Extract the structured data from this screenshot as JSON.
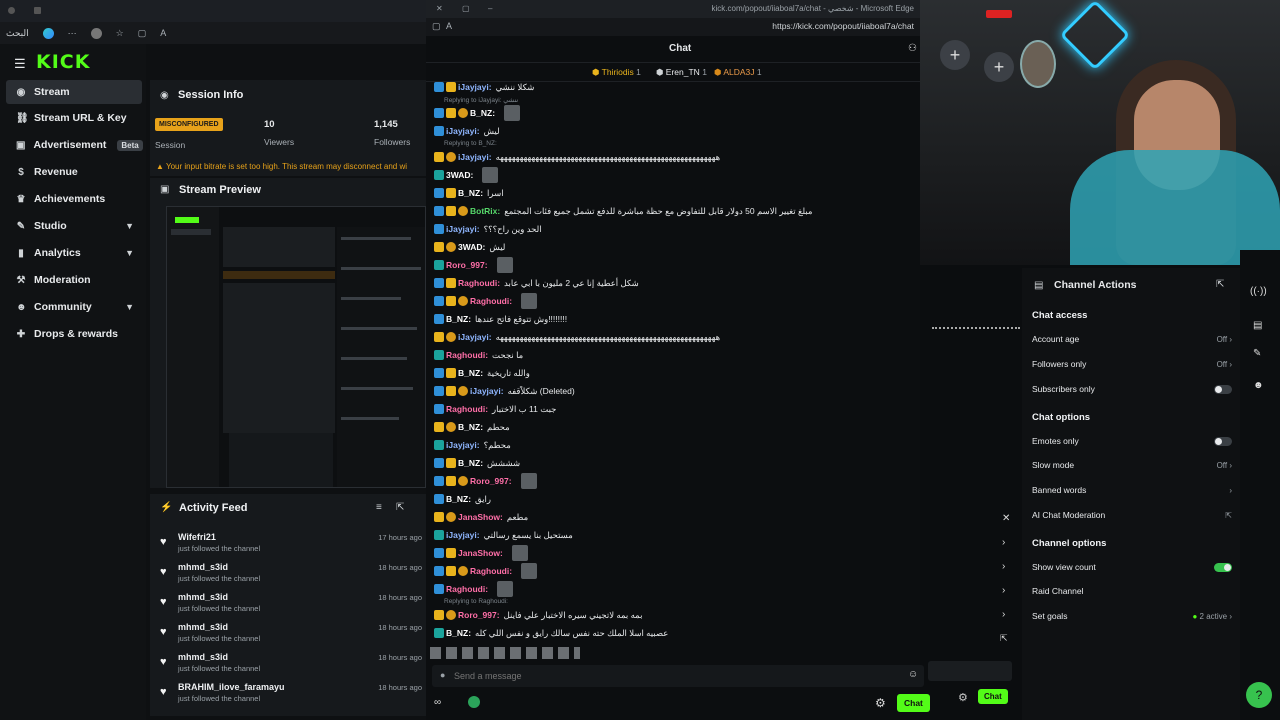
{
  "browser": {
    "search_label": "البحث",
    "chat_window_title": "kick.com/popout/iiaboal7a/chat - شخصي - Microsoft Edge",
    "chat_url": "https://kick.com/popout/iiaboal7a/chat"
  },
  "sidebar": {
    "logo": "KICK",
    "items": [
      {
        "label": "Stream",
        "icon": "broadcast-icon"
      },
      {
        "label": "Stream URL & Key",
        "icon": "link-icon"
      },
      {
        "label": "Advertisement",
        "icon": "ad-icon",
        "badge": "Beta"
      },
      {
        "label": "Revenue",
        "icon": "money-icon"
      },
      {
        "label": "Achievements",
        "icon": "trophy-icon"
      },
      {
        "label": "Studio",
        "icon": "palette-icon"
      },
      {
        "label": "Analytics",
        "icon": "chart-icon"
      },
      {
        "label": "Moderation",
        "icon": "hammer-icon"
      },
      {
        "label": "Community",
        "icon": "people-icon"
      },
      {
        "label": "Drops & rewards",
        "icon": "gift-icon"
      }
    ]
  },
  "session": {
    "title": "Session Info",
    "status_badge": "MISCONFIGURED",
    "status_label": "Session",
    "viewers_value": "10",
    "viewers_label": "Viewers",
    "followers_value": "1,145",
    "followers_label": "Followers",
    "warning": "Your input bitrate is set too high. This stream may disconnect and wi"
  },
  "preview": {
    "title": "Stream Preview"
  },
  "activity": {
    "title": "Activity Feed",
    "items": [
      {
        "name": "Wifefri21",
        "sub": "just followed the channel",
        "time": "17 hours ago"
      },
      {
        "name": "mhmd_s3id",
        "sub": "just followed the channel",
        "time": "18 hours ago"
      },
      {
        "name": "mhmd_s3id",
        "sub": "just followed the channel",
        "time": "18 hours ago"
      },
      {
        "name": "mhmd_s3id",
        "sub": "just followed the channel",
        "time": "18 hours ago"
      },
      {
        "name": "mhmd_s3id",
        "sub": "just followed the channel",
        "time": "18 hours ago"
      },
      {
        "name": "BRAHIM_ilove_faramayu",
        "sub": "just followed the channel",
        "time": "18 hours ago"
      }
    ]
  },
  "chat": {
    "title": "Chat",
    "pinned": [
      {
        "name": "Thiriodis",
        "count": "1"
      },
      {
        "name": "Eren_TN",
        "count": "1"
      },
      {
        "name": "ALDA3J",
        "count": "1"
      }
    ],
    "messages": [
      {
        "user": "iJayjayi:",
        "color": "#8fb6ff",
        "text": "شكلا ننشي",
        "reply": ""
      },
      {
        "user": "B_NZ:",
        "color": "#ffffff",
        "text": "",
        "reply": "Replying to iJayjayi: ننشي"
      },
      {
        "user": "iJayjayi:",
        "color": "#8fb6ff",
        "text": "ليش",
        "reply": ""
      },
      {
        "user": "iJayjayi:",
        "color": "#8fb6ff",
        "text": "ههههههههههههههههههههههههههههههههههههههههههههههههههههههههه",
        "reply": "Replying to B_NZ:"
      },
      {
        "user": "3WAD:",
        "color": "#ffffff",
        "text": "",
        "reply": ""
      },
      {
        "user": "B_NZ:",
        "color": "#ffffff",
        "text": "اسرا",
        "reply": ""
      },
      {
        "user": "BotRix:",
        "color": "#56d86a",
        "text": "مبلغ تغيير الاسم 50 دولار قابل للتفاوض مع حظة مباشرة للدفع تشمل جميع فئات المجتمع",
        "reply": ""
      },
      {
        "user": "iJayjayi:",
        "color": "#8fb6ff",
        "text": "الحد وين راح؟؟؟",
        "reply": ""
      },
      {
        "user": "3WAD:",
        "color": "#ffffff",
        "text": "ليش",
        "reply": ""
      },
      {
        "user": "Roro_997:",
        "color": "#ff6fa8",
        "text": "",
        "reply": ""
      },
      {
        "user": "Raghoudi:",
        "color": "#ff6fa8",
        "text": "شكل أعطية إنا عي 2 مليون با ابي عابد",
        "reply": ""
      },
      {
        "user": "Raghoudi:",
        "color": "#ff6fa8",
        "text": "",
        "reply": ""
      },
      {
        "user": "B_NZ:",
        "color": "#ffffff",
        "text": "وش تتوقع فاتح عندها!!!!!!!!",
        "reply": ""
      },
      {
        "user": "iJayjayi:",
        "color": "#8fb6ff",
        "text": "ههههههههههههههههههههههههههههههههههههههههههههههههههههههههه",
        "reply": ""
      },
      {
        "user": "Raghoudi:",
        "color": "#ff6fa8",
        "text": "ما نجحت",
        "reply": ""
      },
      {
        "user": "B_NZ:",
        "color": "#ffffff",
        "text": "والله تاريخية",
        "reply": ""
      },
      {
        "user": "iJayjayi:",
        "color": "#8fb6ff",
        "text": "شكلاًقفه (Deleted)",
        "reply": ""
      },
      {
        "user": "Raghoudi:",
        "color": "#ff6fa8",
        "text": "جبت 11 ب الاختبار",
        "reply": ""
      },
      {
        "user": "B_NZ:",
        "color": "#ffffff",
        "text": "محطم",
        "reply": ""
      },
      {
        "user": "iJayjayi:",
        "color": "#8fb6ff",
        "text": "محطم؟",
        "reply": ""
      },
      {
        "user": "B_NZ:",
        "color": "#ffffff",
        "text": "شششش",
        "reply": ""
      },
      {
        "user": "Roro_997:",
        "color": "#ff6fa8",
        "text": "",
        "reply": ""
      },
      {
        "user": "B_NZ:",
        "color": "#ffffff",
        "text": "رايق",
        "reply": ""
      },
      {
        "user": "JanaShow:",
        "color": "#ff6fa8",
        "text": "مطعم",
        "reply": ""
      },
      {
        "user": "iJayjayi:",
        "color": "#8fb6ff",
        "text": "مستحيل بنا يسمع رسالتي",
        "reply": ""
      },
      {
        "user": "JanaShow:",
        "color": "#ff6fa8",
        "text": "",
        "reply": ""
      },
      {
        "user": "Raghoudi:",
        "color": "#ff6fa8",
        "text": "",
        "reply": ""
      },
      {
        "user": "Raghoudi:",
        "color": "#ff6fa8",
        "text": "",
        "reply": ""
      },
      {
        "user": "Roro_997:",
        "color": "#ff6fa8",
        "text": "بمه بمه لاتجيني سيره الاختبار علي فاينل",
        "reply": "Replying to Raghoudi:"
      },
      {
        "user": "B_NZ:",
        "color": "#ffffff",
        "text": "عصبيه اسلا الملك حته نفس سالك رايق و نفس اللي كله",
        "reply": ""
      }
    ],
    "input_placeholder": "Send a message",
    "send_label": "Chat"
  },
  "channel_actions": {
    "title": "Channel Actions",
    "chat_access_title": "Chat access",
    "account_age": "Account age",
    "account_age_value": "Off",
    "followers_only": "Followers only",
    "followers_only_value": "Off",
    "subscribers_only": "Subscribers only",
    "chat_options_title": "Chat options",
    "emotes_only": "Emotes only",
    "slow_mode": "Slow mode",
    "slow_mode_value": "Off",
    "banned_words": "Banned words",
    "ai_moderation": "AI Chat Moderation",
    "channel_options_title": "Channel options",
    "show_view_count": "Show view count",
    "raid_channel": "Raid Channel",
    "set_goals": "Set goals",
    "set_goals_value": "2 active"
  },
  "stream_bottom": {
    "send_label": "Chat"
  }
}
